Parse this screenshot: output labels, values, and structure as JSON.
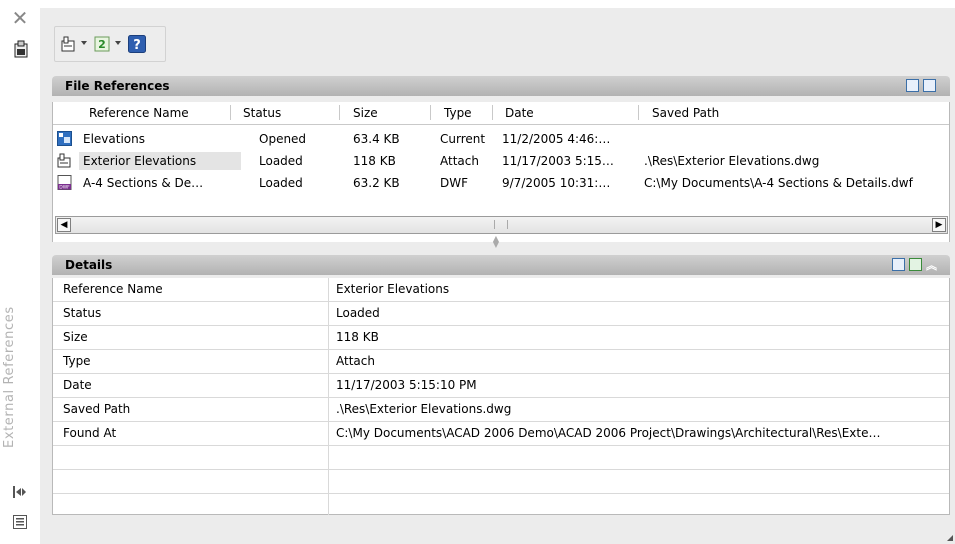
{
  "palette": {
    "vertical_title": "External References",
    "title_close": "close-icon"
  },
  "toolbar": {
    "attach_icon": "attach-dwg-icon",
    "refresh_icon": "refresh-icon",
    "help_icon": "help-icon"
  },
  "file_references": {
    "title": "File References",
    "columns": [
      "Reference Name",
      "Status",
      "Size",
      "Type",
      "Date",
      "Saved Path"
    ],
    "rows": [
      {
        "icon": "drawing-icon",
        "name": "Elevations",
        "status": "Opened",
        "size": "63.4 KB",
        "type": "Current",
        "date": "11/2/2005 4:46:…",
        "saved_path": ""
      },
      {
        "icon": "xref-dwg-icon",
        "name": "Exterior Elevations",
        "status": "Loaded",
        "size": "118 KB",
        "type": "Attach",
        "date": "11/17/2003 5:15…",
        "saved_path": ".\\Res\\Exterior Elevations.dwg"
      },
      {
        "icon": "dwf-file-icon",
        "name": "A-4 Sections & De…",
        "status": "Loaded",
        "size": "63.2 KB",
        "type": "DWF",
        "date": "9/7/2005 10:31:…",
        "saved_path": "C:\\My Documents\\A-4 Sections & Details.dwf"
      }
    ]
  },
  "details": {
    "title": "Details",
    "rows": [
      {
        "label": "Reference Name",
        "value": "Exterior Elevations"
      },
      {
        "label": "Status",
        "value": "Loaded"
      },
      {
        "label": "Size",
        "value": "118 KB"
      },
      {
        "label": "Type",
        "value": "Attach"
      },
      {
        "label": "Date",
        "value": "11/17/2003 5:15:10 PM"
      },
      {
        "label": "Saved Path",
        "value": ".\\Res\\Exterior Elevations.dwg"
      },
      {
        "label": "Found At",
        "value": "C:\\My Documents\\ACAD 2006 Demo\\ACAD 2006 Project\\Drawings\\Architectural\\Res\\Exte…"
      }
    ]
  }
}
